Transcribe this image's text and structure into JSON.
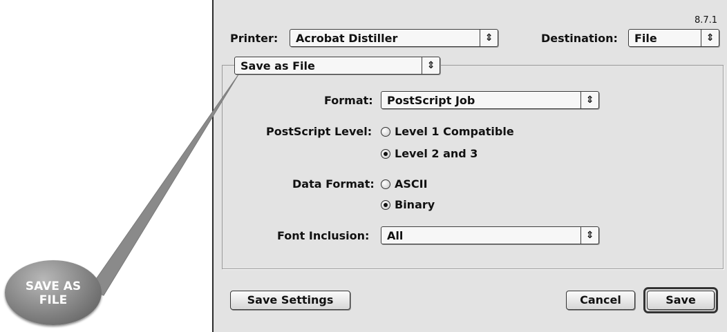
{
  "dialog": {
    "version": "8.7.1",
    "printer_label": "Printer:",
    "printer_value": "Acrobat Distiller",
    "destination_label": "Destination:",
    "destination_value": "File",
    "panel_value": "Save as File"
  },
  "form": {
    "format_label": "Format:",
    "format_value": "PostScript Job",
    "ps_level_label": "PostScript Level:",
    "ps_level_options": [
      {
        "label": "Level 1 Compatible",
        "selected": false
      },
      {
        "label": "Level 2 and 3",
        "selected": true
      }
    ],
    "data_format_label": "Data Format:",
    "data_format_options": [
      {
        "label": "ASCII",
        "selected": false
      },
      {
        "label": "Binary",
        "selected": true
      }
    ],
    "font_inclusion_label": "Font Inclusion:",
    "font_inclusion_value": "All"
  },
  "buttons": {
    "save_settings": "Save Settings",
    "cancel": "Cancel",
    "save": "Save"
  },
  "callout": {
    "text": "SAVE AS FILE"
  },
  "icons": {
    "popup_arrow": "up-down-arrows-icon",
    "radio": "radio-button-icon"
  }
}
